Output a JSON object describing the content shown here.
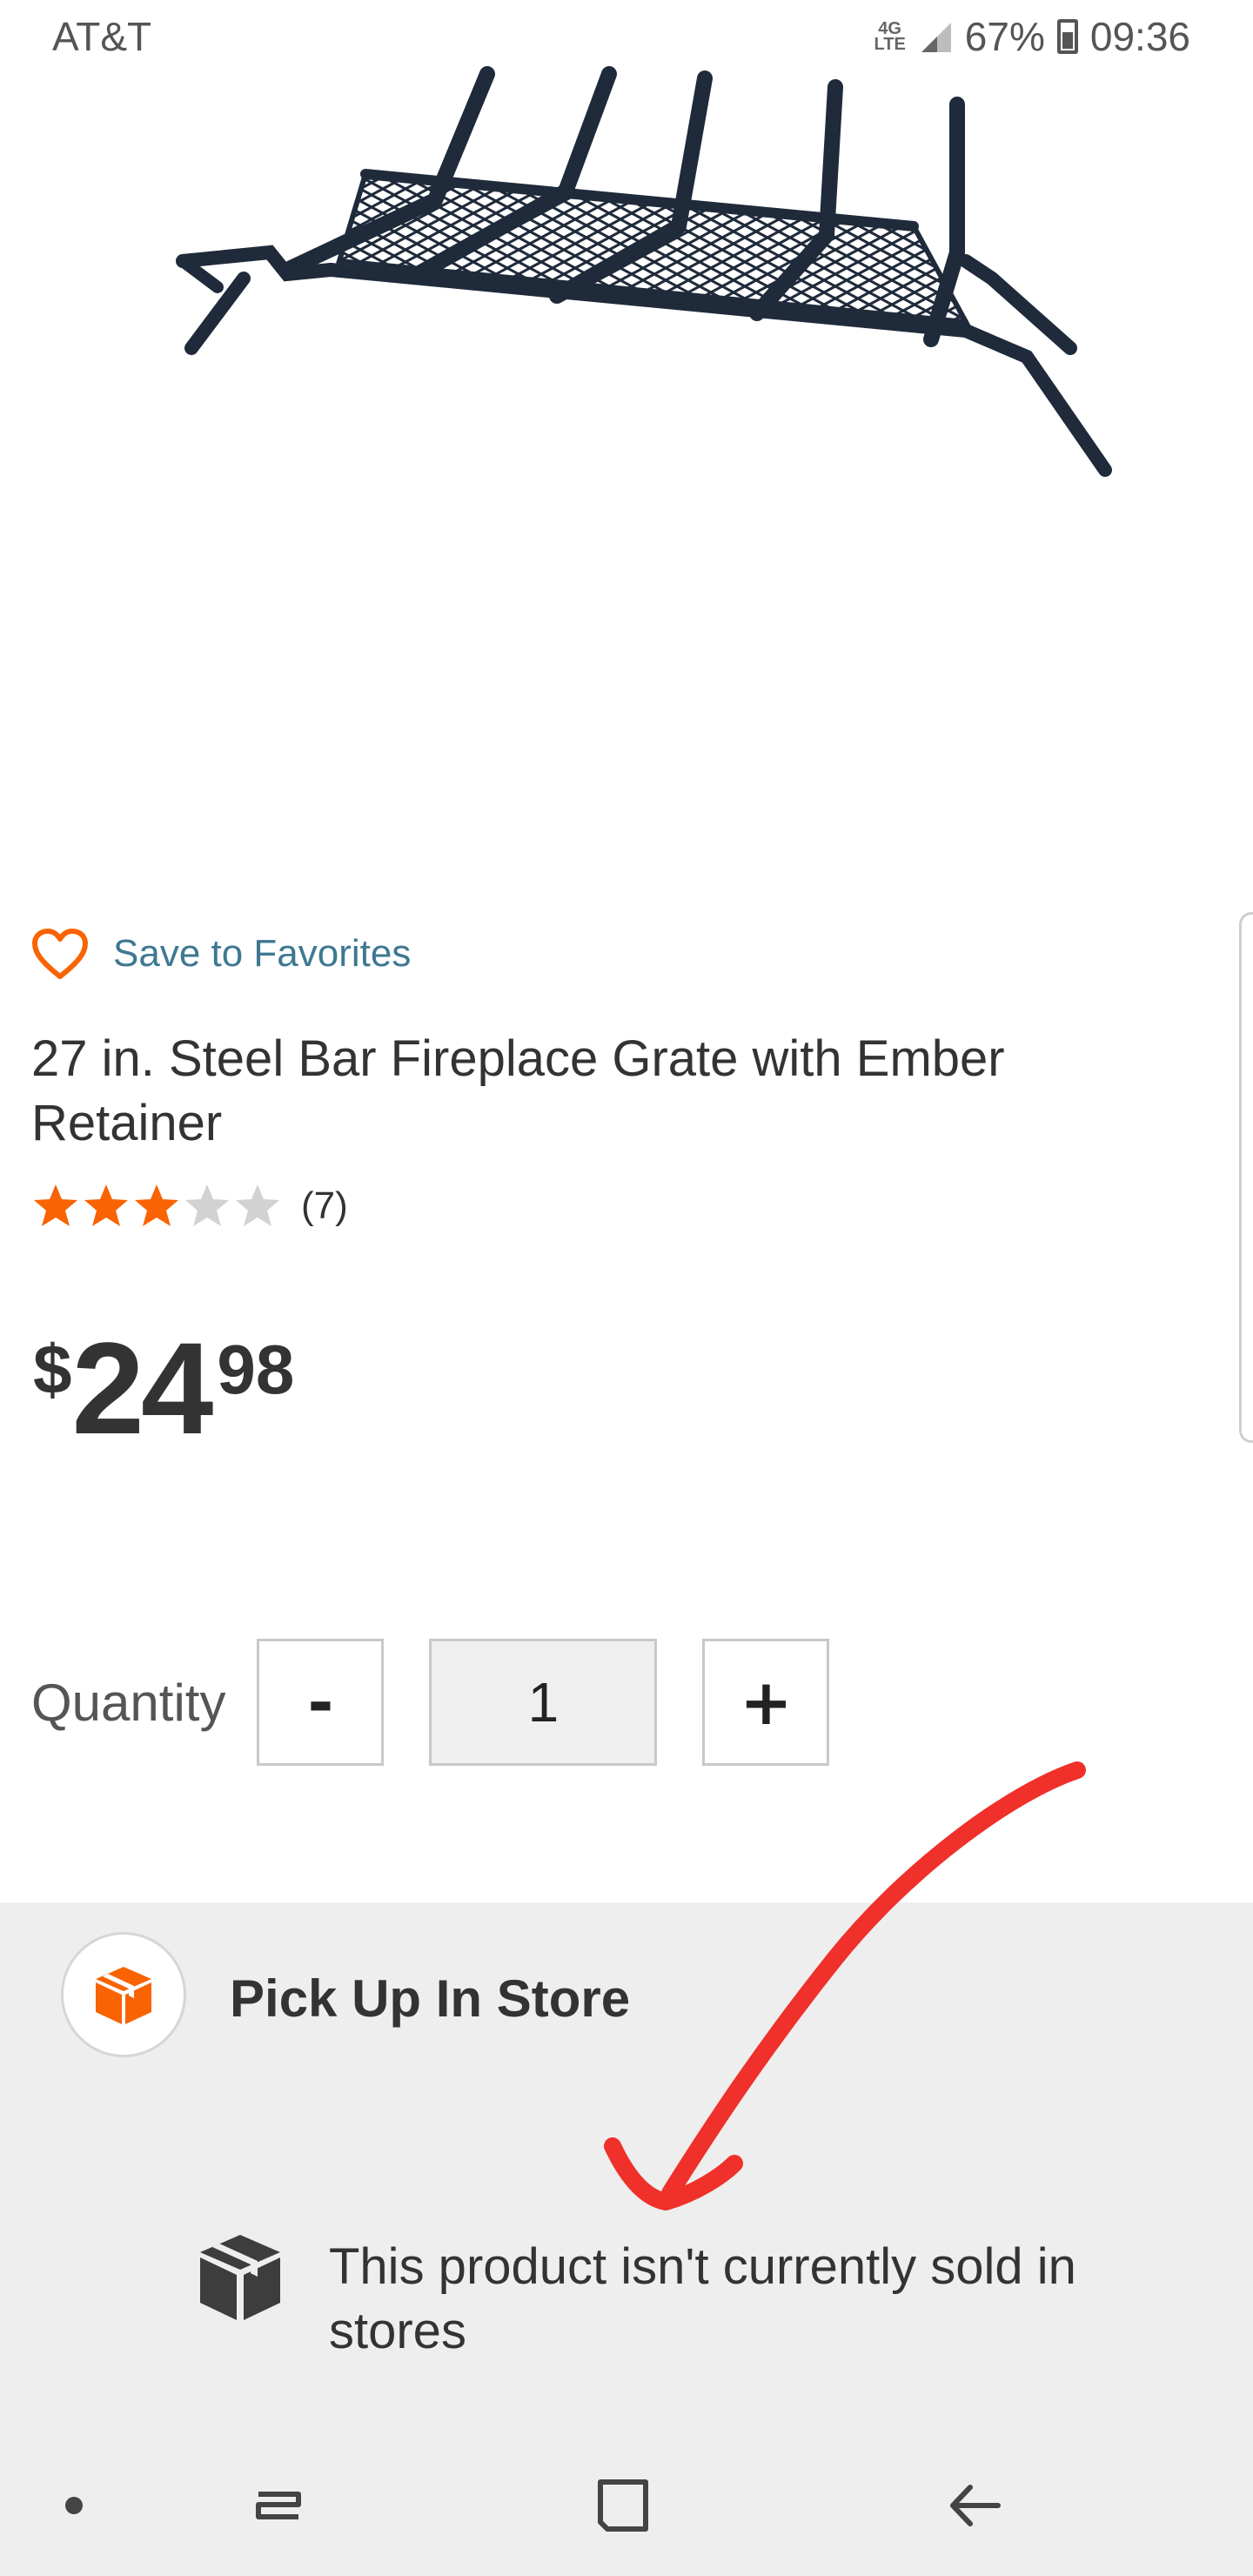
{
  "status_bar": {
    "carrier": "AT&T",
    "network_top": "4G",
    "network_bottom": "LTE",
    "battery": "67%",
    "time": "09:36"
  },
  "product": {
    "image_icon": "fireplace-grate-image",
    "favorites_label": "Save to Favorites",
    "title": "27 in. Steel Bar Fireplace Grate with Ember Retainer",
    "rating": 3,
    "rating_max": 5,
    "review_count": "(7)",
    "price": {
      "symbol": "$",
      "dollars": "24",
      "cents": "98"
    }
  },
  "quantity": {
    "label": "Quantity",
    "decrement": "-",
    "value": "1",
    "increment": "+"
  },
  "pickup": {
    "title": "Pick Up In Store",
    "message": "This product isn't currently sold in stores"
  },
  "colors": {
    "accent_orange": "#f96302",
    "link_blue": "#3e7891",
    "annotation_red": "#f0302a",
    "section_gray": "#eeeeee"
  },
  "icons": {
    "favorites": "heart-icon",
    "pickup": "store-pickup-icon",
    "unavailable": "package-box-icon",
    "nav_dot": "dot-icon",
    "nav_recents": "recent-apps-icon",
    "nav_home": "home-icon",
    "nav_back": "back-arrow-icon"
  }
}
